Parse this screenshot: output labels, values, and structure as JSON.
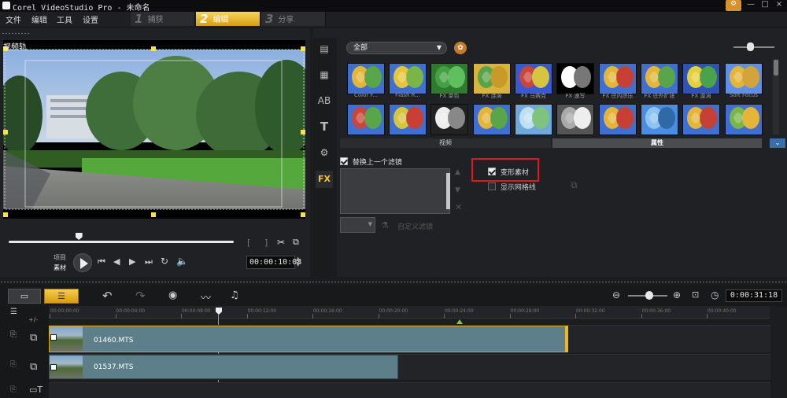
{
  "title_bar": {
    "title": "Corel VideoStudio Pro - 未命名"
  },
  "menu": [
    "文件",
    "编辑",
    "工具",
    "设置"
  ],
  "steps": [
    {
      "num": "1",
      "label": "捕获"
    },
    {
      "num": "2",
      "label": "编辑"
    },
    {
      "num": "3",
      "label": "分享"
    }
  ],
  "preview": {
    "track_label": "视频轨",
    "mode_project": "项目",
    "mode_clip": "素材",
    "timecode": "00:00:10:08",
    "scrub_fraction": 0.31
  },
  "library": {
    "category": "全部",
    "thumbs_row1": [
      "Color F...",
      "Flash R...",
      "FX 单色",
      "FX 涟漪",
      "FX 马赛克",
      "FX 速写",
      "FX 往内挤压",
      "FX 往外扩张",
      "FX 漩涡",
      "Soft Focus"
    ],
    "tab_video": "视频",
    "tab_properties": "属性"
  },
  "attributes": {
    "replace_last_filter": "替换上一个滤镜",
    "distort_clip": "变形素材",
    "show_grid": "显示网格线",
    "custom_filter": "自定义滤镜"
  },
  "timeline": {
    "duration": "0:00:31:18",
    "ruler": [
      "00:00:00:00",
      "00:00:04:00",
      "00:00:08:00",
      "00:00:12:00",
      "00:00:16:00",
      "00:00:20:00",
      "00:00:24:00",
      "00:00:28:00",
      "00:00:32:00",
      "00:00:36:00",
      "00:00:40:00"
    ],
    "clips": [
      {
        "name": "01460.MTS"
      },
      {
        "name": "01537.MTS"
      }
    ]
  },
  "colors": {
    "accent": "#f0b521",
    "highlight_box": "#e0161b",
    "clip": "#5c7f8a"
  }
}
